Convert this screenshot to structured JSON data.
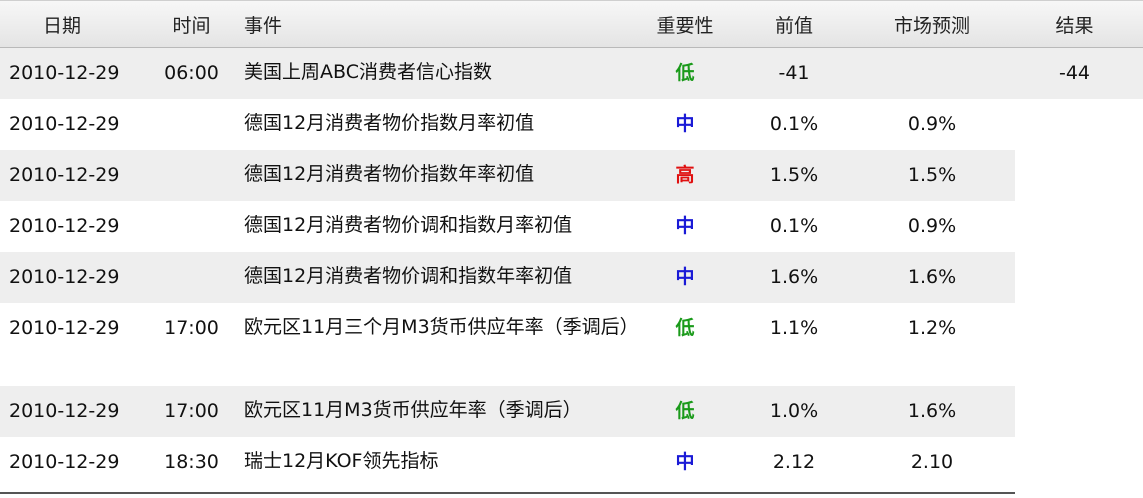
{
  "headers": {
    "date": "日期",
    "time": "时间",
    "event": "事件",
    "importance": "重要性",
    "previous": "前值",
    "forecast": "市场预测",
    "result": "结果"
  },
  "rows": [
    {
      "date": "2010-12-29",
      "time": "06:00",
      "event": "美国上周ABC消费者信心指数",
      "importance": "低",
      "importance_level": "low",
      "previous": "-41",
      "forecast": "",
      "result": "-44"
    },
    {
      "date": "2010-12-29",
      "time": "",
      "event": "德国12月消费者物价指数月率初值",
      "importance": "中",
      "importance_level": "medium",
      "previous": "0.1%",
      "forecast": "0.9%",
      "result": ""
    },
    {
      "date": "2010-12-29",
      "time": "",
      "event": "德国12月消费者物价指数年率初值",
      "importance": "高",
      "importance_level": "high",
      "previous": "1.5%",
      "forecast": "1.5%",
      "result": ""
    },
    {
      "date": "2010-12-29",
      "time": "",
      "event": "德国12月消费者物价调和指数月率初值",
      "importance": "中",
      "importance_level": "medium",
      "previous": "0.1%",
      "forecast": "0.9%",
      "result": ""
    },
    {
      "date": "2010-12-29",
      "time": "",
      "event": "德国12月消费者物价调和指数年率初值",
      "importance": "中",
      "importance_level": "medium",
      "previous": "1.6%",
      "forecast": "1.6%",
      "result": ""
    },
    {
      "date": "2010-12-29",
      "time": "17:00",
      "event": "欧元区11月三个月M3货币供应年率（季调后）",
      "importance": "低",
      "importance_level": "low",
      "previous": "1.1%",
      "forecast": "1.2%",
      "result": ""
    },
    {
      "date": "2010-12-29",
      "time": "17:00",
      "event": "欧元区11月M3货币供应年率（季调后）",
      "importance": "低",
      "importance_level": "low",
      "previous": "1.0%",
      "forecast": "1.6%",
      "result": ""
    },
    {
      "date": "2010-12-29",
      "time": "18:30",
      "event": "瑞士12月KOF领先指标",
      "importance": "中",
      "importance_level": "medium",
      "previous": "2.12",
      "forecast": "2.10",
      "result": ""
    }
  ],
  "colors": {
    "low": "#1a9a1a",
    "medium": "#1a1ad6",
    "high": "#e01010",
    "row_shade": "#eeeeee"
  }
}
